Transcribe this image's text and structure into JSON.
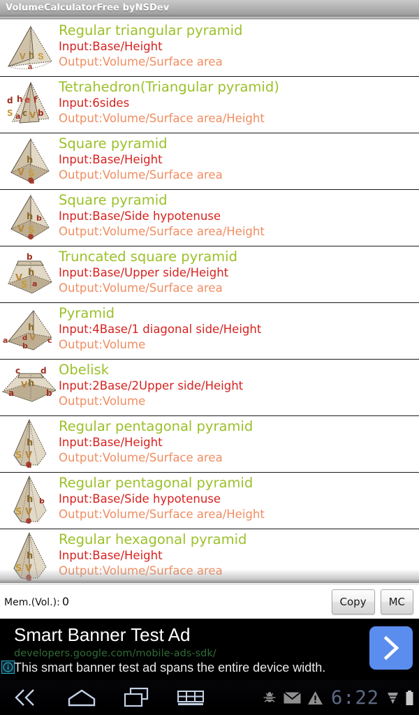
{
  "titlebar": {
    "title": "VolumeCalculatorFree byNSDev"
  },
  "list": {
    "rows": [
      {
        "icon": "triangular-pyramid-icon",
        "name": "Regular triangular pyramid",
        "input": "Input:Base/Height",
        "output": "Output:Volume/Surface area"
      },
      {
        "icon": "tetrahedron-icon",
        "name": "Tetrahedron(Triangular pyramid)",
        "input": "Input:6sides",
        "output": "Output:Volume/Surface area/Height"
      },
      {
        "icon": "square-pyramid-icon",
        "name": "Square pyramid",
        "input": "Input:Base/Height",
        "output": "Output:Volume/Surface area"
      },
      {
        "icon": "square-pyramid-hypotenuse-icon",
        "name": "Square pyramid",
        "input": "Input:Base/Side hypotenuse",
        "output": "Output:Volume/Surface area/Height"
      },
      {
        "icon": "truncated-square-pyramid-icon",
        "name": "Truncated square pyramid",
        "input": "Input:Base/Upper side/Height",
        "output": "Output:Volume/Surface area"
      },
      {
        "icon": "pyramid-icon",
        "name": "Pyramid",
        "input": "Input:4Base/1 diagonal side/Height",
        "output": "Output:Volume"
      },
      {
        "icon": "obelisk-icon",
        "name": "Obelisk",
        "input": "Input:2Base/2Upper side/Height",
        "output": "Output:Volume"
      },
      {
        "icon": "pentagonal-pyramid-icon",
        "name": "Regular pentagonal pyramid",
        "input": "Input:Base/Height",
        "output": "Output:Volume/Surface area"
      },
      {
        "icon": "pentagonal-pyramid-hypotenuse-icon",
        "name": "Regular pentagonal pyramid",
        "input": "Input:Base/Side hypotenuse",
        "output": "Output:Volume/Surface area/Height"
      },
      {
        "icon": "hexagonal-pyramid-icon",
        "name": "Regular hexagonal pyramid",
        "input": "Input:Base/Height",
        "output": "Output:Volume/Surface area"
      }
    ]
  },
  "memory": {
    "label": "Mem.(Vol.):",
    "value": "0",
    "copy_label": "Copy",
    "clear_label": "MC"
  },
  "ad": {
    "headline": "Smart Banner Test Ad",
    "url": "developers.google.com/mobile-ads-sdk/",
    "body": "This smart banner test ad spans the entire device width.",
    "info_icon": "ad-info-icon",
    "cta_icon": "chevron-right-icon",
    "cta_color": "#5b8def"
  },
  "navbar": {
    "buttons": [
      {
        "name": "back-button",
        "icon": "back-icon"
      },
      {
        "name": "home-button",
        "icon": "home-icon"
      },
      {
        "name": "recents-button",
        "icon": "recents-icon"
      },
      {
        "name": "menu-button",
        "icon": "grid-menu-icon"
      }
    ],
    "status": {
      "adb_icon": "bug-icon",
      "mail_icon": "mail-icon",
      "alert_icon": "warning-icon",
      "clock": "6:22",
      "wifi_icon": "wifi-icon",
      "battery_icon": "battery-icon"
    }
  },
  "colors": {
    "name_green": "#9cc02b",
    "input_red": "#d5231f",
    "output_orange": "#f08d61",
    "ad_bg": "#000000",
    "ad_url_green": "#2f6b35"
  }
}
